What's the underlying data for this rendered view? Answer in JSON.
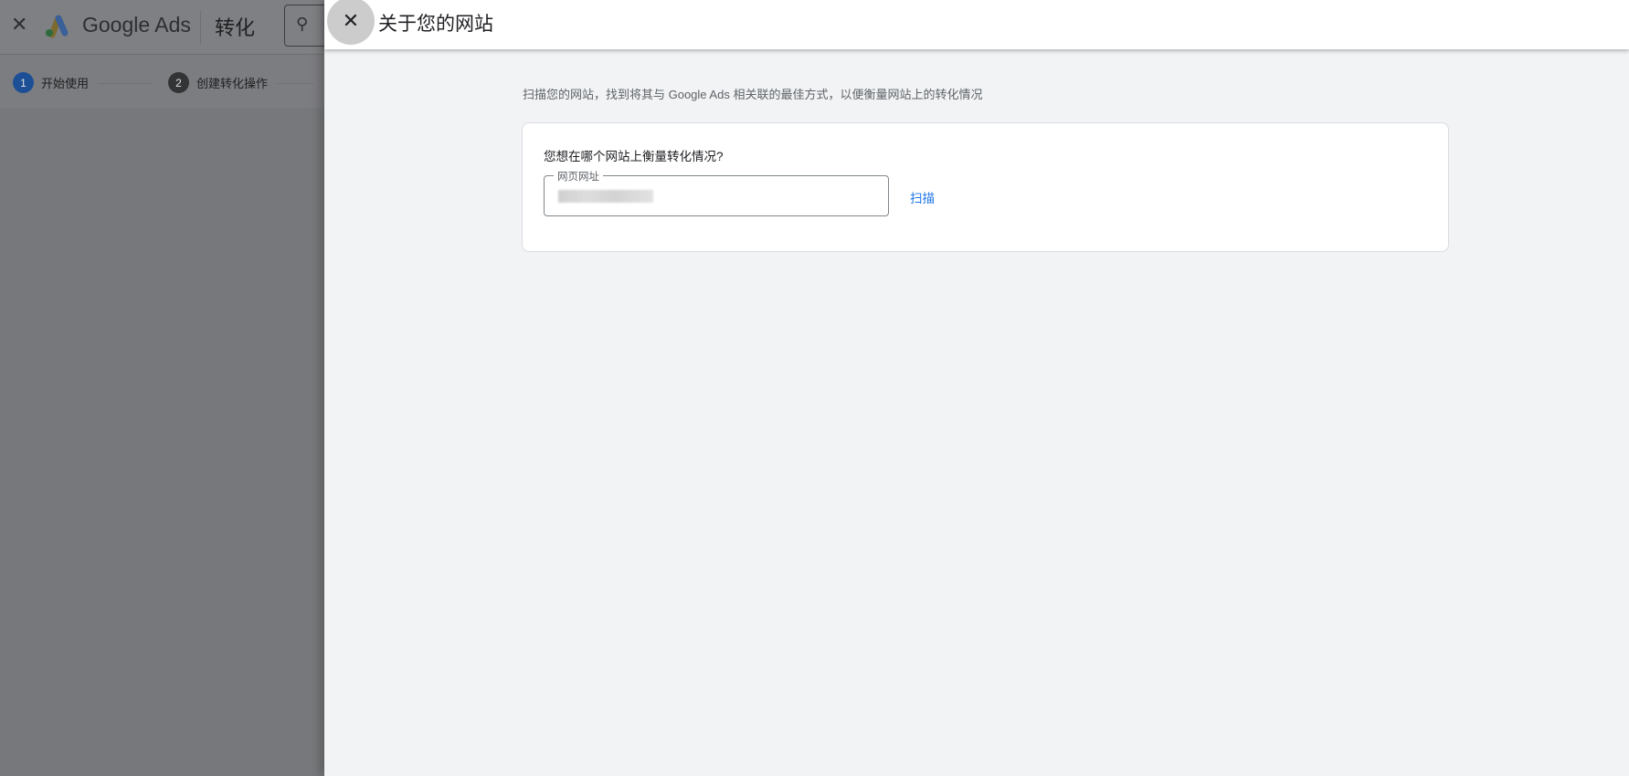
{
  "background": {
    "brand": "Google Ads",
    "page_name": "转化",
    "steps": [
      {
        "number": "1",
        "label": "开始使用"
      },
      {
        "number": "2",
        "label": "创建转化操作"
      }
    ]
  },
  "panel": {
    "title": "关于您的网站",
    "description": "扫描您的网站，找到将其与 Google Ads 相关联的最佳方式，以便衡量网站上的转化情况",
    "card": {
      "question": "您想在哪个网站上衡量转化情况?",
      "url_label": "网页网址",
      "scan_label": "扫描"
    }
  },
  "colors": {
    "accent": "#1a73e8",
    "step_active": "#1a73e8",
    "step_inactive": "#5f6368"
  }
}
